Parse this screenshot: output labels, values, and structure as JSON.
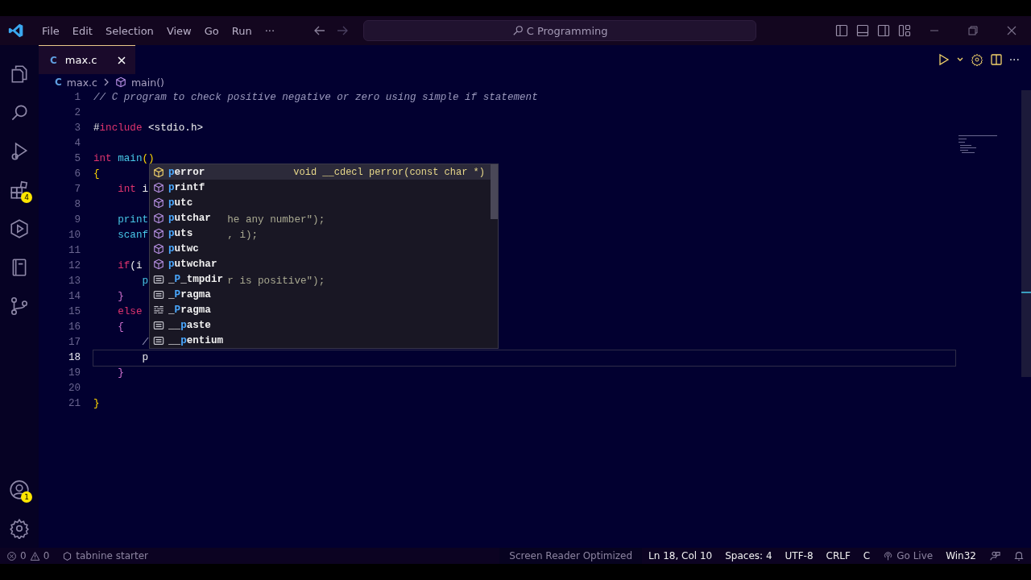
{
  "title_bar": {
    "menus": [
      "File",
      "Edit",
      "Selection",
      "View",
      "Go",
      "Run"
    ],
    "more": "···",
    "search": "C Programming"
  },
  "activity_bar": {
    "top": [
      {
        "kind": "files"
      },
      {
        "kind": "search"
      },
      {
        "kind": "run"
      },
      {
        "kind": "extensions",
        "badge": "4"
      },
      {
        "kind": "hexagon"
      },
      {
        "kind": "book"
      },
      {
        "kind": "source-control"
      }
    ],
    "bottom": [
      {
        "kind": "account",
        "badge": "1"
      },
      {
        "kind": "settings"
      }
    ]
  },
  "tabs": [
    {
      "icon": "C",
      "label": "max.c",
      "selected": true
    }
  ],
  "editor_actions": {
    "more": "···"
  },
  "breadcrumb": {
    "icon": "C",
    "file": "max.c",
    "symbol": "main()"
  },
  "code_lines": [
    {
      "number": "1",
      "current": false,
      "segments": [
        {
          "text": "// C program to check positive negative or zero using simple if statement",
          "kind": "comment"
        }
      ]
    },
    {
      "number": "2",
      "current": false
    },
    {
      "number": "3",
      "current": false,
      "segments": [
        {
          "text": "#",
          "kind": "plain"
        },
        {
          "text": "include",
          "kind": "keyword"
        },
        {
          "text": " <stdio.h>",
          "kind": "plain"
        }
      ]
    },
    {
      "number": "4",
      "current": false
    },
    {
      "number": "5",
      "current": false,
      "segments": [
        {
          "text": "int",
          "kind": "keyword"
        },
        {
          "text": " main",
          "kind": "function"
        },
        {
          "text": "()",
          "kind": "bracket"
        }
      ]
    },
    {
      "number": "6",
      "current": false,
      "segments": [
        {
          "text": "{",
          "kind": "bracket"
        }
      ]
    },
    {
      "number": "7",
      "current": false,
      "segments": [
        {
          "text": "    int",
          "kind": "keyword"
        },
        {
          "text": " i",
          "kind": "plain"
        }
      ]
    },
    {
      "number": "8",
      "current": false
    },
    {
      "number": "9",
      "current": false,
      "segments": [
        {
          "text": "    print",
          "kind": "function"
        },
        {
          "text": "he any number\");",
          "kind": "ghost"
        }
      ]
    },
    {
      "number": "10",
      "current": false,
      "segments": [
        {
          "text": "    scanf",
          "kind": "function"
        },
        {
          "text": ", i);",
          "kind": "ghost"
        }
      ]
    },
    {
      "number": "11",
      "current": false
    },
    {
      "number": "12",
      "current": false,
      "segments": [
        {
          "text": "    if",
          "kind": "keyword"
        },
        {
          "text": "(i",
          "kind": "plain"
        }
      ]
    },
    {
      "number": "13",
      "current": false,
      "segments": [
        {
          "text": "        p",
          "kind": "function"
        },
        {
          "text": "r is positive\");",
          "kind": "ghost"
        }
      ]
    },
    {
      "number": "14",
      "current": false,
      "segments": [
        {
          "text": "    }",
          "kind": "bracket2"
        }
      ]
    },
    {
      "number": "15",
      "current": false,
      "segments": [
        {
          "text": "    else",
          "kind": "keyword"
        }
      ]
    },
    {
      "number": "16",
      "current": false,
      "segments": [
        {
          "text": "    {",
          "kind": "bracket2"
        }
      ]
    },
    {
      "number": "17",
      "current": false,
      "segments": [
        {
          "text": "        /",
          "kind": "comment"
        }
      ]
    },
    {
      "number": "18",
      "current": true,
      "segments": [
        {
          "text": "        p",
          "kind": "plain"
        }
      ]
    },
    {
      "number": "19",
      "current": false,
      "segments": [
        {
          "text": "    }",
          "kind": "bracket2"
        }
      ]
    },
    {
      "number": "20",
      "current": false
    },
    {
      "number": "21",
      "current": false,
      "segments": [
        {
          "text": "}",
          "kind": "bracket"
        }
      ]
    }
  ],
  "suggestions": [
    {
      "label": "**p**error",
      "kind": "function",
      "selected": true,
      "detail": "void __cdecl perror(const char *)"
    },
    {
      "label": "**p**rintf",
      "kind": "function",
      "selected": false
    },
    {
      "label": "**p**utc",
      "kind": "function",
      "selected": false
    },
    {
      "label": "**p**utchar",
      "kind": "function",
      "selected": false
    },
    {
      "label": "**p**uts",
      "kind": "function",
      "selected": false
    },
    {
      "label": "**p**utwc",
      "kind": "function",
      "selected": false
    },
    {
      "label": "**p**utwchar",
      "kind": "function",
      "selected": false
    },
    {
      "label": "_**P**_tmpdir",
      "kind": "text",
      "selected": false
    },
    {
      "label": "_**P**ragma",
      "kind": "text",
      "selected": false
    },
    {
      "label": "_**P**ragma",
      "kind": "snippet",
      "selected": false
    },
    {
      "label": "__**p**aste",
      "kind": "text",
      "selected": false
    },
    {
      "label": "__**p**entium",
      "kind": "text",
      "selected": false
    }
  ],
  "status_bar": {
    "errors": "0",
    "warnings": "0",
    "tabnine": "tabnine starter",
    "right": [
      {
        "text": "Screen Reader Optimized",
        "kind": "highlighted"
      },
      {
        "text": "Ln 18, Col 10",
        "kind": "plain"
      },
      {
        "text": "Spaces: 4",
        "kind": "plain"
      },
      {
        "text": "UTF-8",
        "kind": "plain"
      },
      {
        "text": "CRLF",
        "kind": "plain"
      },
      {
        "text": "C",
        "kind": "plain"
      },
      {
        "text": "Go Live",
        "kind": "live"
      },
      {
        "text": "Win32",
        "kind": "plain"
      }
    ]
  }
}
